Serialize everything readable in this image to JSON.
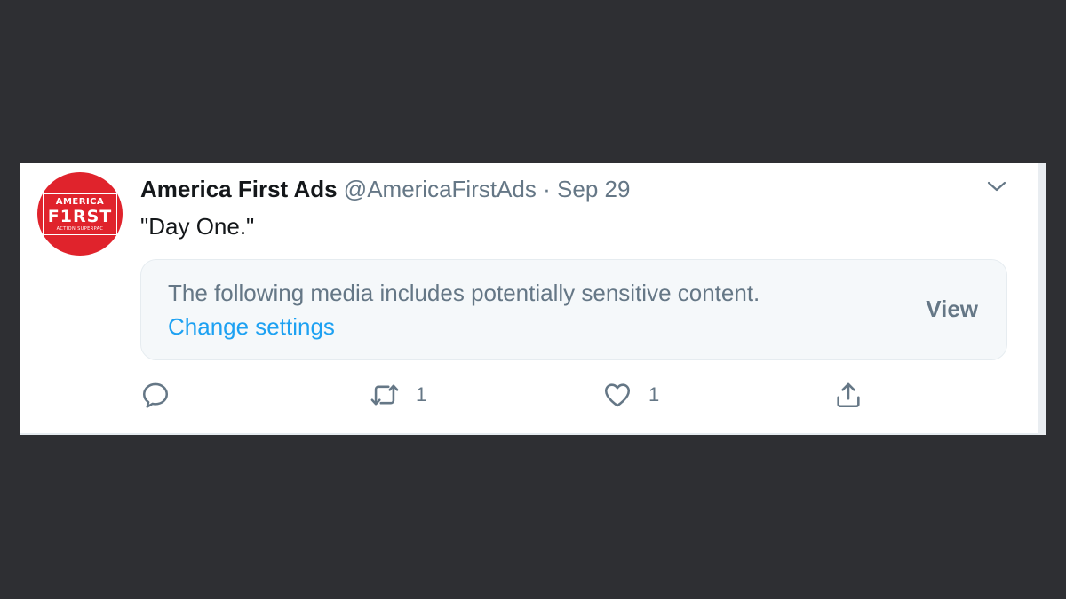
{
  "tweet": {
    "avatar": {
      "line1": "AMERICA",
      "line2": "F1RST",
      "line3": "ACTION SUPERPAC",
      "color": "#e0232c"
    },
    "display_name": "America First Ads",
    "handle": "@AmericaFirstAds",
    "separator": "·",
    "date": "Sep 29",
    "text": "\"Day One.\"",
    "sensitive_notice": {
      "message": "The following media includes potentially sensitive content.",
      "link_label": "Change settings",
      "view_label": "View"
    },
    "actions": {
      "reply": {
        "icon": "reply-icon",
        "count": ""
      },
      "retweet": {
        "icon": "retweet-icon",
        "count": "1"
      },
      "like": {
        "icon": "heart-icon",
        "count": "1"
      },
      "share": {
        "icon": "share-icon",
        "count": ""
      }
    }
  },
  "colors": {
    "background": "#2e2f33",
    "link": "#1da1f2",
    "secondary_text": "#657786",
    "primary_text": "#14171a",
    "notice_bg": "#f5f8fa"
  }
}
